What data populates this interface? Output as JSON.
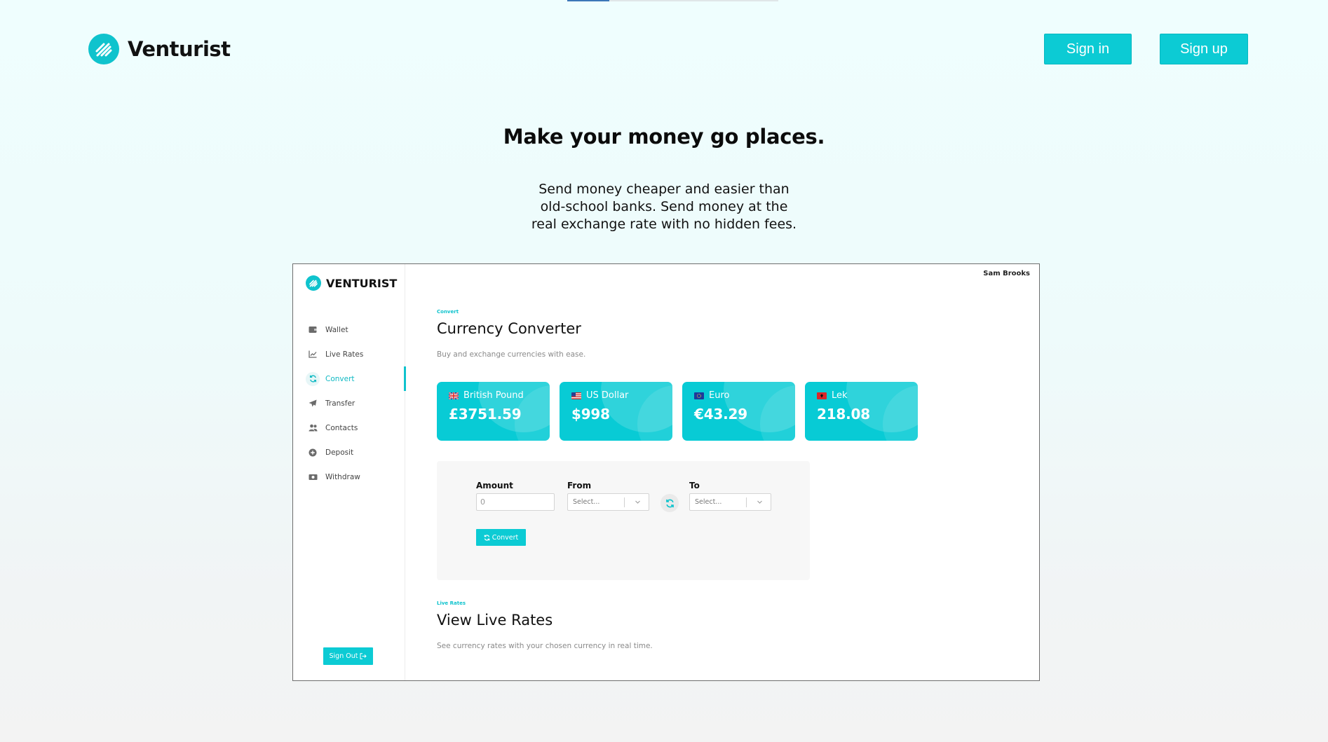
{
  "brand": {
    "name": "Venturist"
  },
  "header": {
    "sign_in": "Sign in",
    "sign_up": "Sign up"
  },
  "hero": {
    "title": "Make your money go places.",
    "subtitle": "Send money cheaper and easier than old-school banks. Send money at the real exchange rate with no hidden fees."
  },
  "app": {
    "logo_text": "VENTURIST",
    "user_name": "Sam Brooks",
    "nav": [
      {
        "label": "Wallet",
        "icon": "wallet-icon",
        "active": false
      },
      {
        "label": "Live Rates",
        "icon": "line-chart-icon",
        "active": false
      },
      {
        "label": "Convert",
        "icon": "refresh-icon",
        "active": true
      },
      {
        "label": "Transfer",
        "icon": "paper-plane-icon",
        "active": false
      },
      {
        "label": "Contacts",
        "icon": "users-icon",
        "active": false
      },
      {
        "label": "Deposit",
        "icon": "plus-circle-icon",
        "active": false
      },
      {
        "label": "Withdraw",
        "icon": "money-bill-icon",
        "active": false
      }
    ],
    "sign_out": "Sign Out",
    "converter": {
      "eyebrow": "Convert",
      "title": "Currency Converter",
      "description": "Buy and exchange currencies with ease.",
      "cards": [
        {
          "currency": "British Pound",
          "amount": "£3751.59",
          "flag": "uk-flag-icon"
        },
        {
          "currency": "US Dollar",
          "amount": "$998",
          "flag": "us-flag-icon"
        },
        {
          "currency": "Euro",
          "amount": "€43.29",
          "flag": "eu-flag-icon"
        },
        {
          "currency": "Lek",
          "amount": "218.08",
          "flag": "albania-flag-icon"
        }
      ],
      "form": {
        "amount_label": "Amount",
        "amount_value": "0",
        "from_label": "From",
        "from_placeholder": "Select...",
        "to_label": "To",
        "to_placeholder": "Select...",
        "convert_button": "Convert"
      }
    },
    "live_rates": {
      "eyebrow": "Live Rates",
      "title": "View Live Rates",
      "description": "See currency rates with your chosen currency in real time."
    }
  },
  "colors": {
    "accent": "#0ccbd4",
    "card": "#08cbd5",
    "progress": "#3c77b8"
  },
  "page_progress": 0.2
}
